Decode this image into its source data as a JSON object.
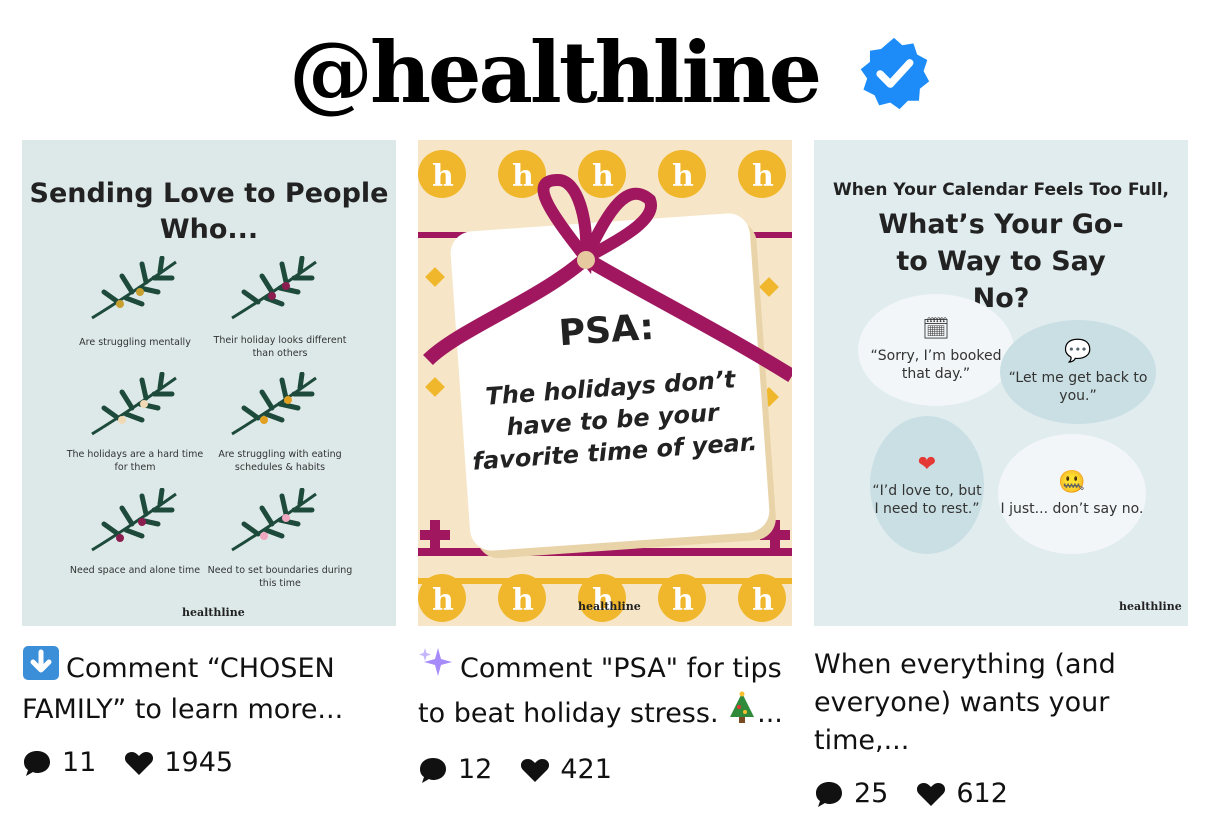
{
  "header": {
    "handle": "@healthline",
    "verified_icon": "verified-badge-icon",
    "verified_color": "#1d8cf8"
  },
  "posts": [
    {
      "image": {
        "title": "Sending Love to People Who...",
        "items": [
          "Are struggling mentally",
          "Their holiday looks different than others",
          "The holidays are a hard time for them",
          "Are struggling with eating schedules & habits",
          "Need space and alone time",
          "Need to set boundaries during this time"
        ],
        "brand": "healthline",
        "bg_color": "#dde9e9"
      },
      "caption_icon": "down-arrow-icon",
      "caption": "Comment “CHOSEN FAMILY” to learn more...",
      "comments": "11",
      "likes": "1945"
    },
    {
      "image": {
        "title": "PSA:",
        "lines": [
          "The holidays don’t",
          "have to be your",
          "favorite time of year."
        ],
        "brand": "healthline",
        "bg_color": "#f6e6c7",
        "ribbon_color": "#a0175f"
      },
      "caption_icon": "sparkles-icon",
      "caption": "Comment \"PSA\" for tips to beat holiday stress.",
      "caption_trailing_icon": "christmas-tree-icon",
      "caption_tail": "...",
      "comments": "12",
      "likes": "421"
    },
    {
      "image": {
        "subtitle": "When Your Calendar Feels Too Full,",
        "title": "What’s Your Go-to Way to Say No?",
        "bubbles": [
          "“Sorry, I’m booked that day.”",
          "“Let me get back to you.”",
          "“I’d love to, but I need to rest.”",
          "I just... don’t say no."
        ],
        "brand": "healthline",
        "bg_color": "#e1ecef"
      },
      "caption": "When everything (and everyone) wants your time,...",
      "comments": "25",
      "likes": "612"
    }
  ]
}
